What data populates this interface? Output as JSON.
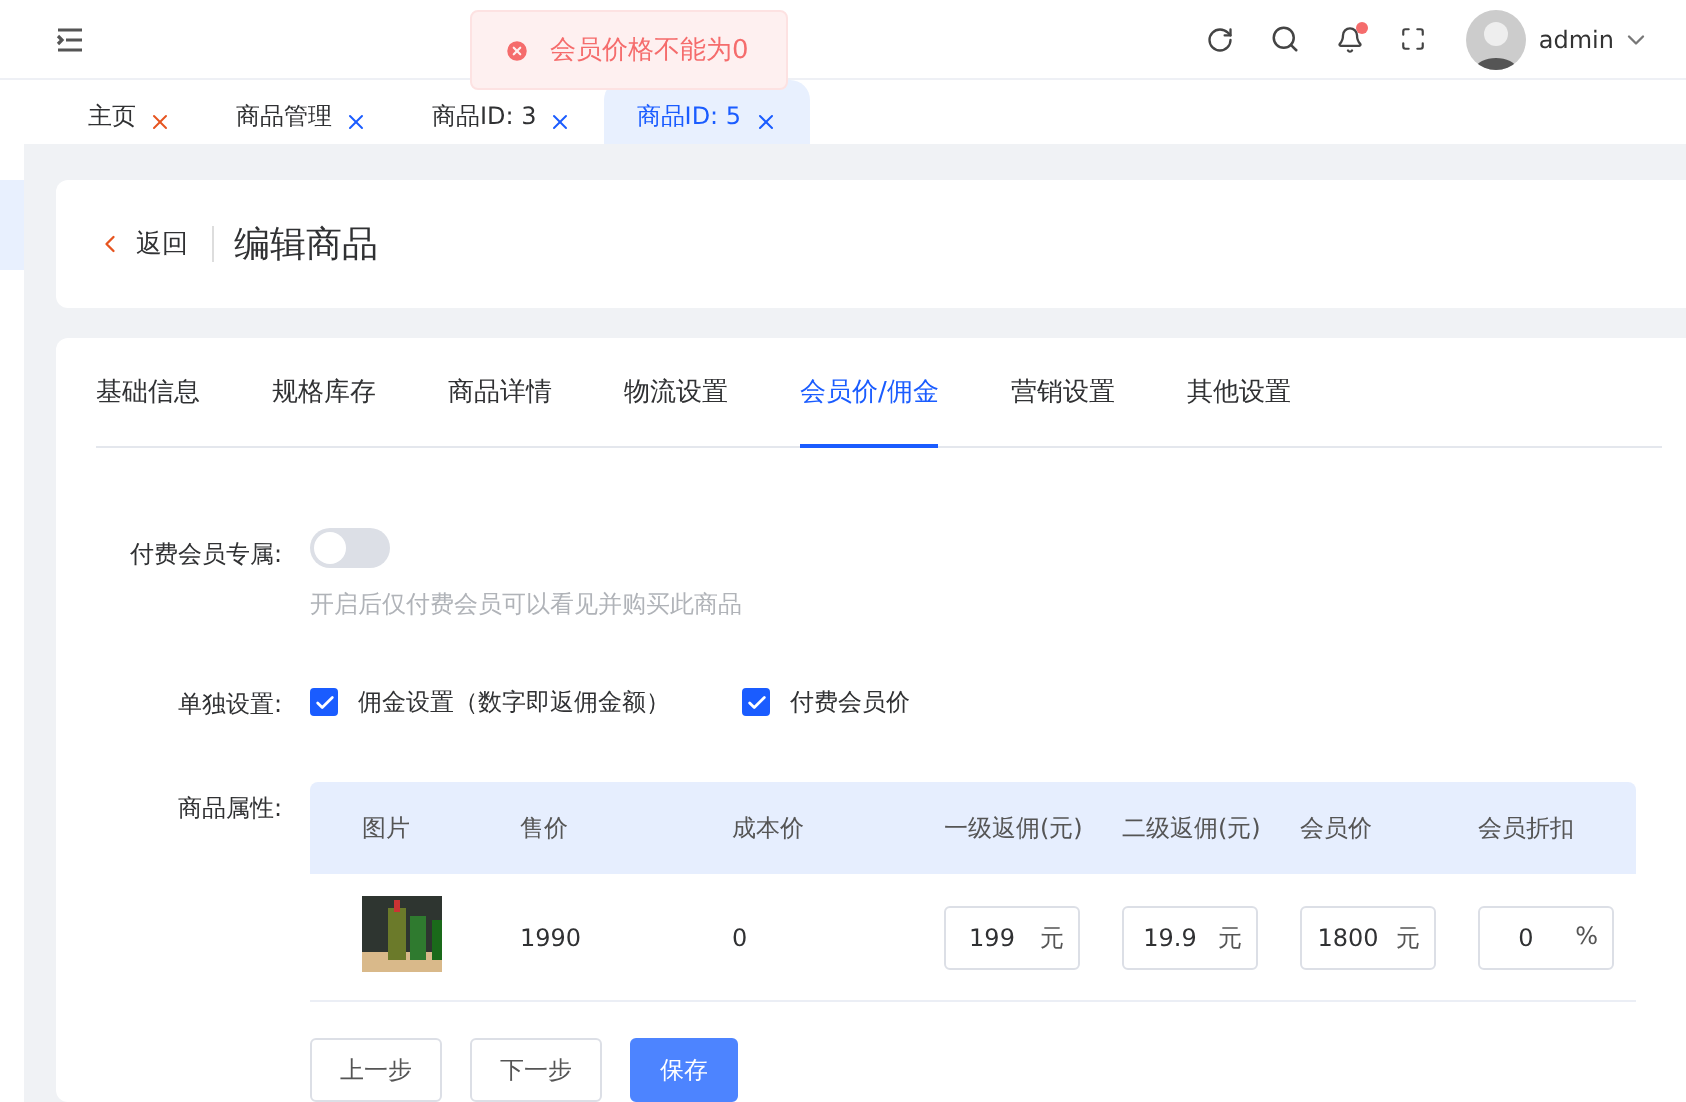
{
  "header": {
    "user": "admin",
    "notification_dot": true
  },
  "toast": {
    "kind": "error",
    "message": "会员价格不能为0"
  },
  "tabs": [
    {
      "label": "主页",
      "selected": false
    },
    {
      "label": "商品管理",
      "selected": false
    },
    {
      "label": "商品ID: 3",
      "selected": false
    },
    {
      "label": "商品ID: 5",
      "selected": true
    }
  ],
  "page_header": {
    "back": "返回",
    "title": "编辑商品"
  },
  "form_tabs": [
    {
      "label": "基础信息",
      "selected": false
    },
    {
      "label": "规格库存",
      "selected": false
    },
    {
      "label": "商品详情",
      "selected": false
    },
    {
      "label": "物流设置",
      "selected": false
    },
    {
      "label": "会员价/佣金",
      "selected": true
    },
    {
      "label": "营销设置",
      "selected": false
    },
    {
      "label": "其他设置",
      "selected": false
    }
  ],
  "member_only": {
    "label": "付费会员专属:",
    "on": false,
    "hint": "开启后仅付费会员可以看见并购买此商品"
  },
  "separate": {
    "label": "单独设置:",
    "options": [
      {
        "label": "佣金设置（数字即返佣金额）",
        "checked": true
      },
      {
        "label": "付费会员价",
        "checked": true
      }
    ]
  },
  "attributes": {
    "label": "商品属性:",
    "columns": [
      "图片",
      "售价",
      "成本价",
      "一级返佣(元)",
      "二级返佣(元)",
      "会员价",
      "会员折扣"
    ],
    "rows": [
      {
        "price": "1990",
        "cost": "0",
        "inputs": [
          {
            "value": "199",
            "unit": "元"
          },
          {
            "value": "19.9",
            "unit": "元"
          },
          {
            "value": "1800",
            "unit": "元"
          },
          {
            "value": "0",
            "unit": "%"
          }
        ]
      }
    ]
  },
  "buttons": [
    {
      "label": "上一步",
      "kind": "default"
    },
    {
      "label": "下一步",
      "kind": "default"
    },
    {
      "label": "保存",
      "kind": "primary"
    }
  ]
}
